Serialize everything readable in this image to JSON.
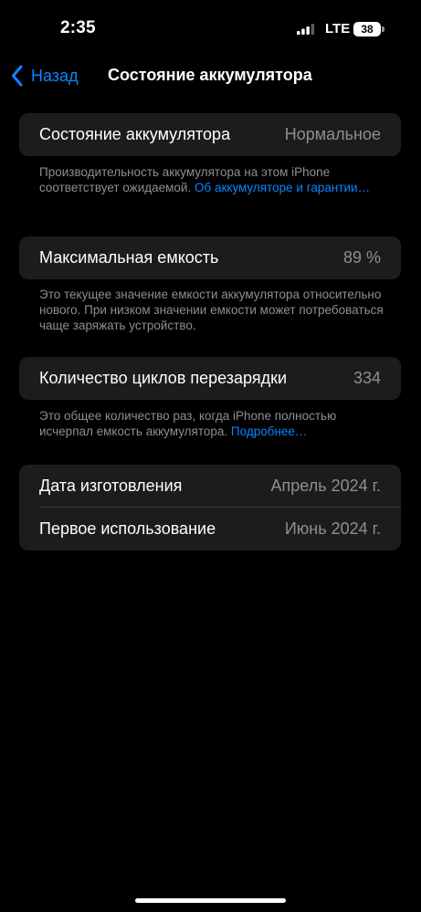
{
  "status_bar": {
    "time": "2:35",
    "network": "LTE",
    "battery_level": "38"
  },
  "nav": {
    "back_label": "Назад",
    "title": "Состояние аккумулятора"
  },
  "health": {
    "label": "Состояние аккумулятора",
    "value": "Нормальное",
    "footnote_text": "Производительность аккумулятора на этом iPhone соответствует ожидаемой. ",
    "footnote_link": "Об аккумуляторе и гарантии…"
  },
  "capacity": {
    "label": "Максимальная емкость",
    "value": "89 %",
    "footnote_text": "Это текущее значение емкости аккумулятора относительно нового. При низком значении емкости может потребоваться чаще заряжать устройство."
  },
  "cycles": {
    "label": "Количество циклов перезарядки",
    "value": "334",
    "footnote_text": "Это общее количество раз, когда iPhone полностью исчерпал емкость аккумулятора. ",
    "footnote_link": "Подробнее…"
  },
  "dates": {
    "manufacture_label": "Дата изготовления",
    "manufacture_value": "Апрель 2024 г.",
    "first_use_label": "Первое использование",
    "first_use_value": "Июнь 2024 г."
  },
  "colors": {
    "accent": "#0a84ff",
    "background": "#000000",
    "cell": "#1c1c1e",
    "secondary_text": "#8e8e93"
  }
}
